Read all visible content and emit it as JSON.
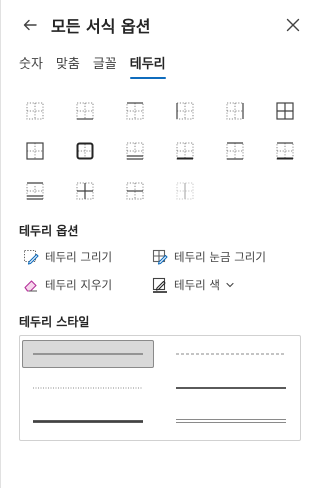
{
  "header": {
    "title": "모든 서식 옵션"
  },
  "tabs": [
    {
      "label": "숫자"
    },
    {
      "label": "맞춤"
    },
    {
      "label": "글꼴"
    },
    {
      "label": "테두리",
      "active": true
    }
  ],
  "colors": {
    "accent": "#0f6cbd",
    "icon": "#616161",
    "selected_bg": "#d9d9d9"
  },
  "border_options": {
    "title": "테두리 옵션",
    "draw_border": "테두리 그리기",
    "draw_border_grid": "테두리 눈금 그리기",
    "erase_border": "테두리 지우기",
    "border_color": "테두리 색"
  },
  "border_style": {
    "title": "테두리 스타일"
  }
}
